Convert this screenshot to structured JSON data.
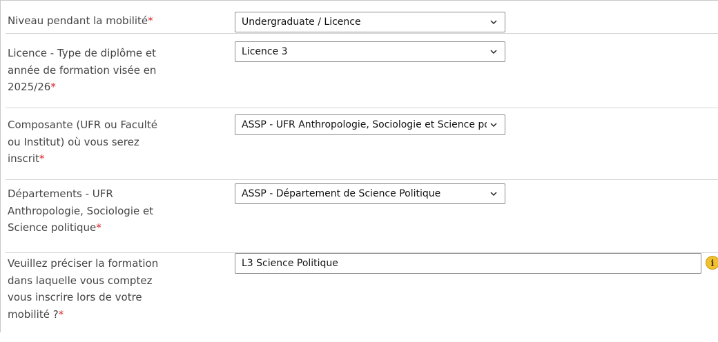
{
  "required_marker": "*",
  "colors": {
    "required": "#d9262c",
    "label_text": "#444444",
    "info_icon": "#f2c12e"
  },
  "fields": {
    "niveau": {
      "label": "Niveau pendant la mobilité",
      "value": "Undergraduate / Licence",
      "icon": "chevron-down-icon"
    },
    "licence": {
      "label_lines": [
        "Licence - Type de diplôme et",
        "année de formation visée en",
        "2025/26"
      ],
      "value": "Licence 3",
      "icon": "chevron-down-icon"
    },
    "composante": {
      "label_lines": [
        "Composante (UFR ou Faculté",
        "ou Institut) où vous serez",
        "inscrit"
      ],
      "value": "ASSP - UFR Anthropologie, Sociologie et Science politique",
      "icon": "chevron-down-icon"
    },
    "departements": {
      "label_lines": [
        "Départements - UFR",
        "Anthropologie, Sociologie et",
        "Science politique"
      ],
      "value": "ASSP - Département de Science Politique",
      "icon": "chevron-down-icon"
    },
    "formation": {
      "label_lines": [
        "Veuillez préciser la formation",
        "dans laquelle vous comptez",
        "vous inscrire lors de votre",
        "mobilité ?"
      ],
      "value": "L3 Science Politique",
      "icon": "info-icon"
    }
  }
}
